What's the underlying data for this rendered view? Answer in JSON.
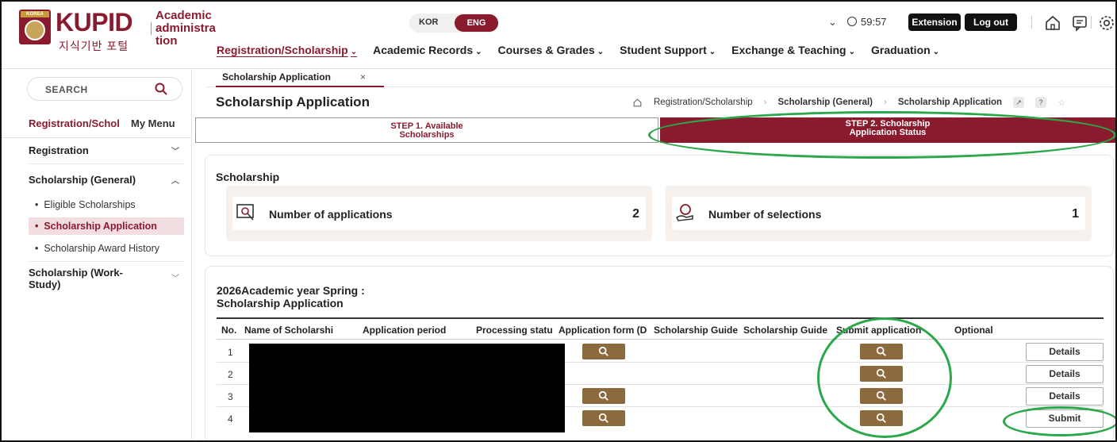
{
  "header": {
    "brand": "KUPID",
    "brand_sub": "지식기반 포털",
    "seal_text": "KOREA",
    "app_name": "Academic administra tion",
    "lang": {
      "kor": "KOR",
      "eng": "ENG"
    },
    "timer": "59:57",
    "extension_label": "Extension",
    "logout_label": "Log out",
    "nav": [
      {
        "label": "Registration/Scholarship",
        "active": true
      },
      {
        "label": "Academic Records"
      },
      {
        "label": "Courses & Grades"
      },
      {
        "label": "Student Support"
      },
      {
        "label": "Exchange & Teaching"
      },
      {
        "label": "Graduation"
      }
    ]
  },
  "sidebar": {
    "search_placeholder": "SEARCH",
    "tabs": [
      "Registration/Schol",
      "My Menu"
    ],
    "sections": [
      {
        "label": "Registration",
        "arrow": "﹀"
      },
      {
        "label": "Scholarship (General)",
        "arrow": "︿",
        "items": [
          "Eligible Scholarships",
          "Scholarship Application",
          "Scholarship Award History"
        ]
      },
      {
        "label": "Scholarship (Work-Study)",
        "arrow": "﹀"
      }
    ]
  },
  "main": {
    "page_tab": "Scholarship Application",
    "page_tab_close": "×",
    "title": "Scholarship Application",
    "breadcrumb": [
      "Registration/Scholarship",
      "Scholarship (General)",
      "Scholarship Application"
    ],
    "step1": "STEP 1. Available Scholarships",
    "step2": "STEP 2. Scholarship Application Status",
    "summary": {
      "heading": "Scholarship",
      "applications_label": "Number of applications",
      "applications_value": "2",
      "selections_label": "Number of selections",
      "selections_value": "1"
    },
    "list": {
      "heading": "2026Academic year Spring : Scholarship Application",
      "columns": [
        "No.",
        "Name of Scholarshi",
        "Application period",
        "Processing statu",
        "Application form (D",
        "Scholarship Guide",
        "Scholarship Guide",
        "Submit application",
        "Optional"
      ],
      "rows": [
        {
          "no": "1",
          "form": true,
          "submit": true,
          "action": "Details"
        },
        {
          "no": "2",
          "form": false,
          "submit": true,
          "action": "Details"
        },
        {
          "no": "3",
          "form": true,
          "submit": true,
          "action": "Details"
        },
        {
          "no": "4",
          "form": true,
          "submit": true,
          "action": "Submit"
        }
      ]
    }
  },
  "colors": {
    "brand": "#8a1b2e",
    "annotation": "#2aa84a",
    "button_brown": "#8b6a3e"
  }
}
